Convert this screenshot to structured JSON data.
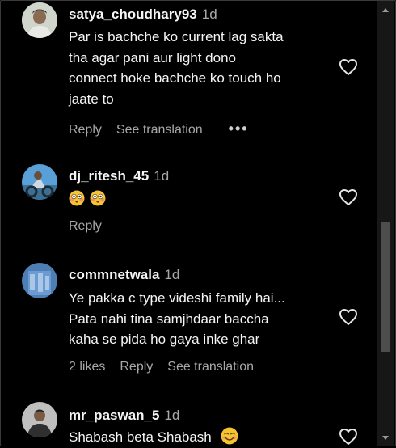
{
  "comments": [
    {
      "username": "satya_choudhary93",
      "time": "1d",
      "text_lines": [
        "Par is bachche ko current lag sakta",
        "tha agar pani aur light dono",
        "connect hoke bachche ko touch ho",
        "jaate to"
      ],
      "reply_label": "Reply",
      "translate_label": "See translation",
      "more_label": "•••"
    },
    {
      "username": "dj_ritesh_45",
      "time": "1d",
      "emojis": [
        "flushed-face",
        "flushed-face"
      ],
      "reply_label": "Reply"
    },
    {
      "username": "commnetwala",
      "time": "1d",
      "text_lines": [
        "Ye pakka c type videshi family hai...",
        "Pata nahi tina samjhdaar baccha",
        "kaha se pida ho gaya inke ghar"
      ],
      "likes_label": "2 likes",
      "reply_label": "Reply",
      "translate_label": "See translation"
    },
    {
      "username": "mr_paswan_5",
      "time": "1d",
      "text": "Shabash beta Shabash",
      "emoji": "smiling-face-with-smiling-eyes"
    }
  ],
  "icons": {
    "like": "heart-outline-icon",
    "scroll_up": "triangle-up-icon",
    "scroll_down": "triangle-down-icon"
  },
  "colors": {
    "background": "#000000",
    "text": "#f5f5f5",
    "muted": "#a8a8a8"
  }
}
